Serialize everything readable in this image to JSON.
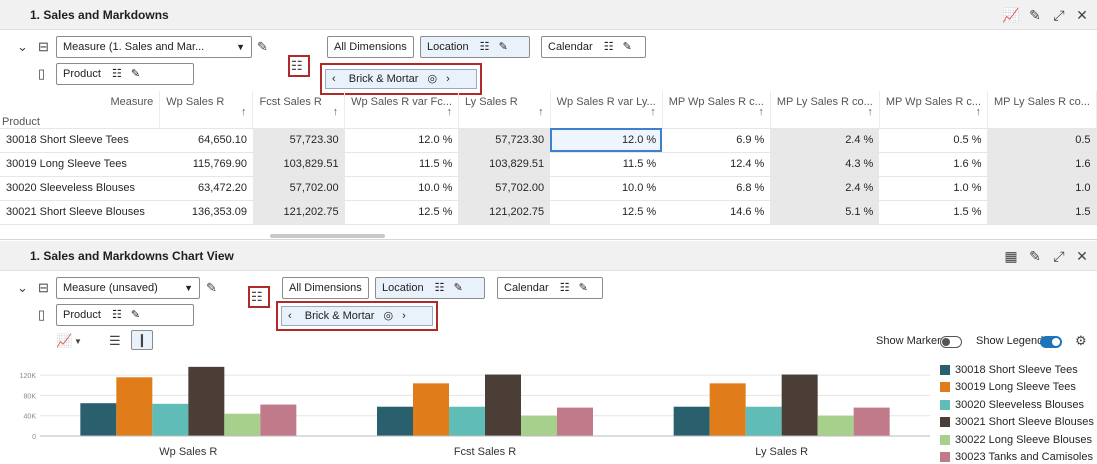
{
  "panel1": {
    "title": "1. Sales and Markdowns",
    "measure_select": "Measure (1. Sales and Mar...",
    "all_dimensions": "All Dimensions",
    "location": "Location",
    "calendar": "Calendar",
    "product": "Product",
    "crumb": "Brick & Mortar",
    "grid": {
      "corner_top": "Measure",
      "corner_bottom": "Product",
      "columns": [
        "Wp Sales R",
        "Fcst Sales R",
        "Wp Sales R var Fc...",
        "Ly Sales R",
        "Wp Sales R var Ly...",
        "MP Wp Sales R c...",
        "MP Ly Sales R co...",
        "MP Wp Sales R c...",
        "MP Ly Sales R co..."
      ],
      "rows": [
        {
          "product": "30018 Short Sleeve Tees",
          "values": [
            "64,650.10",
            "57,723.30",
            "12.0 %",
            "57,723.30",
            "12.0 %",
            "6.9 %",
            "2.4 %",
            "0.5 %",
            "0.5"
          ]
        },
        {
          "product": "30019 Long Sleeve Tees",
          "values": [
            "115,769.90",
            "103,829.51",
            "11.5 %",
            "103,829.51",
            "11.5 %",
            "12.4 %",
            "4.3 %",
            "1.6 %",
            "1.6"
          ]
        },
        {
          "product": "30020 Sleeveless Blouses",
          "values": [
            "63,472.20",
            "57,702.00",
            "10.0 %",
            "57,702.00",
            "10.0 %",
            "6.8 %",
            "2.4 %",
            "1.0 %",
            "1.0"
          ]
        },
        {
          "product": "30021 Short Sleeve Blouses",
          "values": [
            "136,353.09",
            "121,202.75",
            "12.5 %",
            "121,202.75",
            "12.5 %",
            "14.6 %",
            "5.1 %",
            "1.5 %",
            "1.5"
          ]
        }
      ]
    }
  },
  "panel2": {
    "title": "1. Sales and Markdowns Chart View",
    "measure_select": "Measure (unsaved)",
    "all_dimensions": "All Dimensions",
    "location": "Location",
    "calendar": "Calendar",
    "product": "Product",
    "crumb": "Brick & Mortar",
    "show_marker": "Show Marker",
    "show_legend": "Show Legend"
  },
  "chart_data": {
    "type": "bar",
    "categories": [
      "Wp Sales R",
      "Fcst Sales R",
      "Ly Sales R"
    ],
    "y_ticks": [
      "120K",
      "80K",
      "40K",
      "0"
    ],
    "ylim": [
      0,
      140000
    ],
    "series": [
      {
        "name": "30018 Short Sleeve Tees",
        "color": "#2a5f6e",
        "values": [
          64650,
          57723,
          57723
        ]
      },
      {
        "name": "30019 Long Sleeve Tees",
        "color": "#e07c1a",
        "values": [
          115770,
          103830,
          103830
        ]
      },
      {
        "name": "30020 Sleeveless Blouses",
        "color": "#5fbcb6",
        "values": [
          63472,
          57702,
          57702
        ]
      },
      {
        "name": "30021 Short Sleeve Blouses",
        "color": "#4b3e36",
        "values": [
          136353,
          121203,
          121203
        ]
      },
      {
        "name": "30022 Long Sleeve Blouses",
        "color": "#a8d08d",
        "values": [
          44000,
          40000,
          40000
        ]
      },
      {
        "name": "30023 Tanks and Camisoles",
        "color": "#c07a8a",
        "values": [
          62000,
          56000,
          56000
        ]
      }
    ]
  }
}
